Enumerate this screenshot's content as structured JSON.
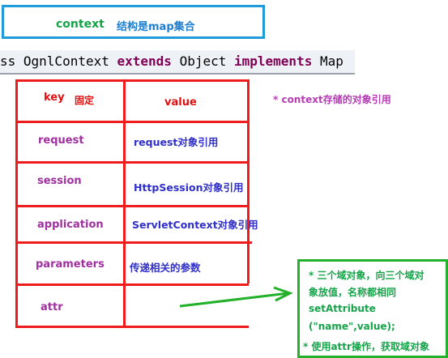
{
  "header_box": {
    "context": "context",
    "description": "结构是map集合"
  },
  "code": {
    "prefix": "ss OgnlContext ",
    "kw1": "extends",
    "mid": " Object ",
    "kw2": "implements",
    "end": " Map"
  },
  "table": {
    "header_key": "key",
    "header_key_note": "固定",
    "header_value": "value",
    "rows": [
      {
        "key": "request",
        "value": "request对象引用"
      },
      {
        "key": "session",
        "value": "HttpSession对象引用"
      },
      {
        "key": "application",
        "value": "ServletContext对象引用"
      },
      {
        "key": "parameters",
        "value": "传递相关的参数"
      },
      {
        "key": "attr",
        "value": ""
      }
    ]
  },
  "side_note": "* context存储的对象引用",
  "green_note": {
    "lines": [
      "* 三个域对象，向三个域对",
      "象放值，名称都相同",
      "setAttribute",
      "(\"name\",value);",
      "* 使用attr操作，获取域对象"
    ]
  },
  "colors": {
    "table_border": "#ee1c1c",
    "blue_box": "#1e9bd8",
    "green": "#23b02a"
  }
}
